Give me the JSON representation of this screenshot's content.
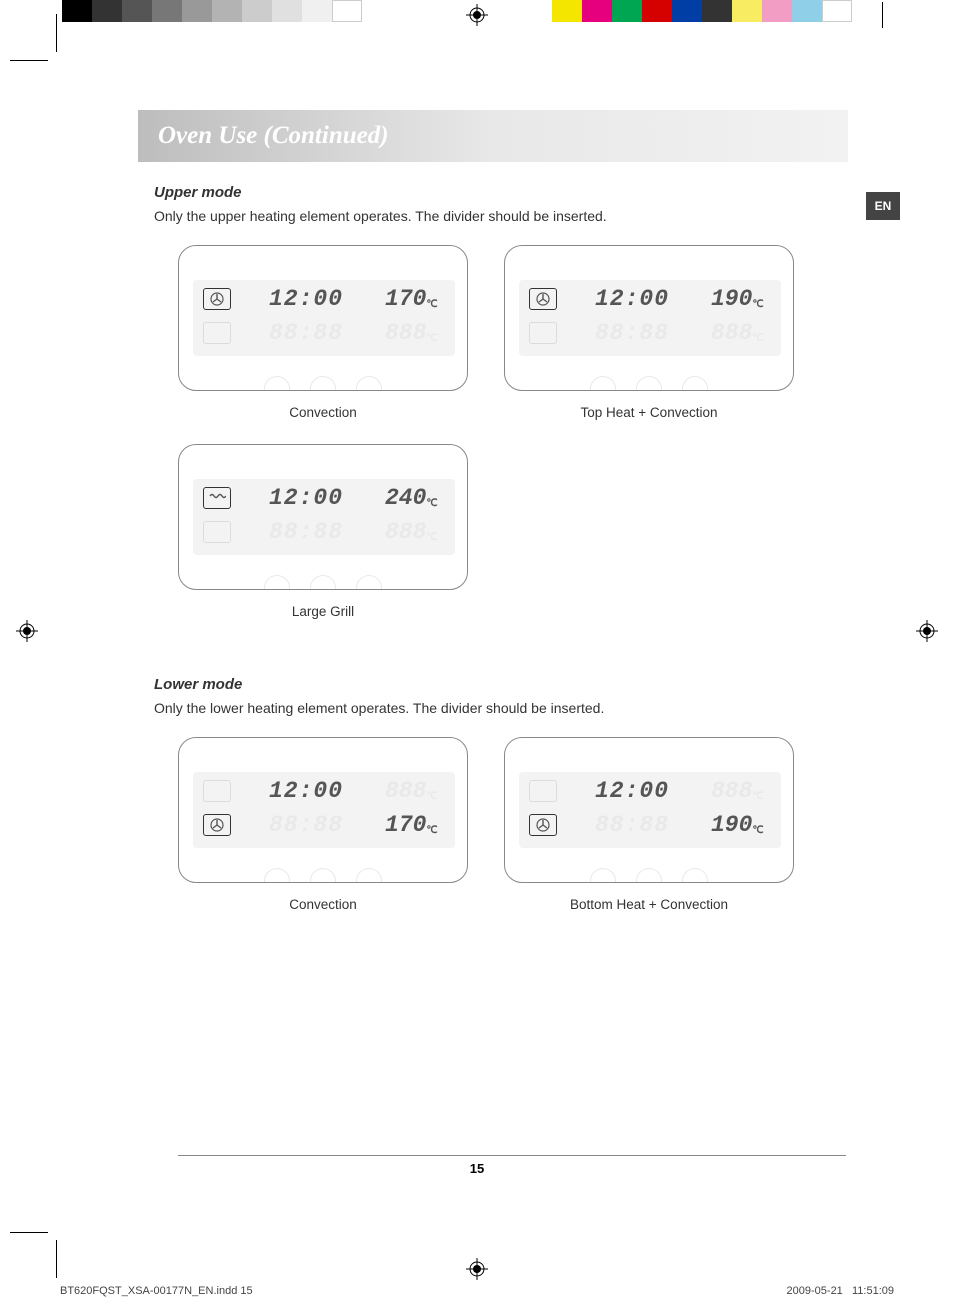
{
  "title": "Oven Use (Continued)",
  "lang_tab": "EN",
  "upper": {
    "heading": "Upper mode",
    "text": "Only the upper heating element operates. The divider should be inserted.",
    "displays": [
      {
        "icon": "fan",
        "active_row": "top",
        "time": "12:00",
        "temp": "170",
        "unit": "℃",
        "ghost_time": "88:88",
        "ghost_temp": "888",
        "caption": "Convection"
      },
      {
        "icon": "fan",
        "active_row": "top",
        "time": "12:00",
        "temp": "190",
        "unit": "℃",
        "ghost_time": "88:88",
        "ghost_temp": "888",
        "caption": "Top Heat + Convection"
      },
      {
        "icon": "grill",
        "active_row": "top",
        "time": "12:00",
        "temp": "240",
        "unit": "℃",
        "ghost_time": "88:88",
        "ghost_temp": "888",
        "caption": "Large Grill"
      }
    ]
  },
  "lower": {
    "heading": "Lower mode",
    "text": "Only the lower heating element operates. The divider should be inserted.",
    "displays": [
      {
        "icon": "fan",
        "active_row": "bottom",
        "time": "12:00",
        "temp": "170",
        "unit": "℃",
        "ghost_time": "88:88",
        "ghost_temp": "888",
        "caption": "Convection"
      },
      {
        "icon": "fan",
        "active_row": "bottom",
        "time": "12:00",
        "temp": "190",
        "unit": "℃",
        "ghost_time": "88:88",
        "ghost_temp": "888",
        "caption": "Bottom Heat + Convection"
      }
    ]
  },
  "page_number": "15",
  "footer": {
    "file": "BT620FQST_XSA-00177N_EN.indd   15",
    "date": "2009-05-21",
    "time": "11:51:09"
  },
  "colorbar": {
    "grays": [
      "#000000",
      "#333333",
      "#555555",
      "#777777",
      "#999999",
      "#b3b3b3",
      "#cccccc",
      "#e0e0e0",
      "#f0f0f0",
      "#ffffff"
    ],
    "colors": [
      "#f5e600",
      "#e6007e",
      "#00a651",
      "#d50000",
      "#003da5",
      "#333333",
      "#f8ed62",
      "#f29ec4",
      "#8fd0e8",
      "#ffffff"
    ]
  }
}
